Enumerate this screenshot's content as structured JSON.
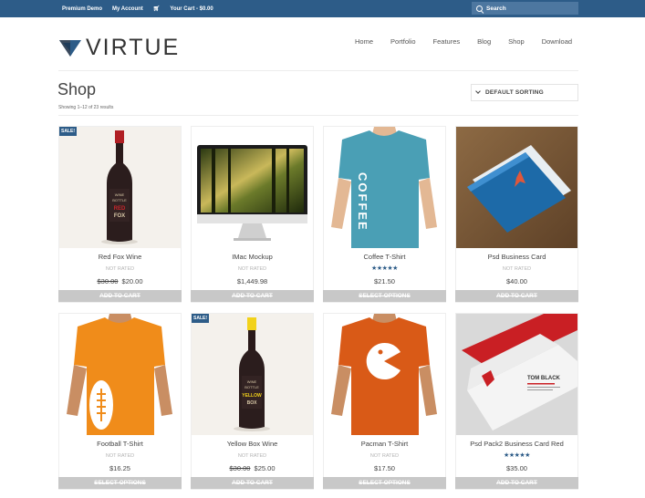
{
  "topbar": {
    "links": [
      "Premium Demo",
      "My Account",
      "Your Cart - $0.00"
    ],
    "search_placeholder": "Search"
  },
  "header": {
    "logo_text": "VIRTUE",
    "nav": [
      "Home",
      "Portfolio",
      "Features",
      "Blog",
      "Shop",
      "Download"
    ]
  },
  "page": {
    "title": "Shop",
    "results": "Showing 1–12 of 23 results",
    "sorting": "DEFAULT SORTING"
  },
  "products": [
    {
      "name": "Red Fox Wine",
      "rating_text": "NOT RATED",
      "old_price": "$30.00",
      "price": "$20.00",
      "button": "ADD TO CART",
      "sale": "SALE!"
    },
    {
      "name": "IMac Mockup",
      "rating_text": "NOT RATED",
      "price": "$1,449.98",
      "button": "ADD TO CART"
    },
    {
      "name": "Coffee T-Shirt",
      "stars": "★★★★★",
      "price": "$21.50",
      "button": "SELECT OPTIONS"
    },
    {
      "name": "Psd Business Card",
      "rating_text": "NOT RATED",
      "price": "$40.00",
      "button": "ADD TO CART"
    },
    {
      "name": "Football T-Shirt",
      "rating_text": "NOT RATED",
      "price": "$16.25",
      "button": "SELECT OPTIONS"
    },
    {
      "name": "Yellow Box Wine",
      "rating_text": "NOT RATED",
      "old_price": "$30.00",
      "price": "$25.00",
      "button": "ADD TO CART",
      "sale": "SALE!"
    },
    {
      "name": "Pacman T-Shirt",
      "rating_text": "NOT RATED",
      "price": "$17.50",
      "button": "SELECT OPTIONS"
    },
    {
      "name": "Psd Pack2 Business Card Red",
      "stars": "★★★★★",
      "price": "$35.00",
      "button": "ADD TO CART"
    }
  ],
  "image_text": {
    "coffee_print": "COFFEE",
    "wine1_label": [
      "WINE",
      "BOTTLE",
      "RED",
      "FOX"
    ],
    "wine2_label": [
      "WINE",
      "BOTTLE",
      "YELLOW",
      "BOX"
    ],
    "card_name": "TOM BLACK"
  },
  "colors": {
    "brand": "#2d5c88",
    "button": "#c8c8c8",
    "star": "#2d5c88"
  }
}
